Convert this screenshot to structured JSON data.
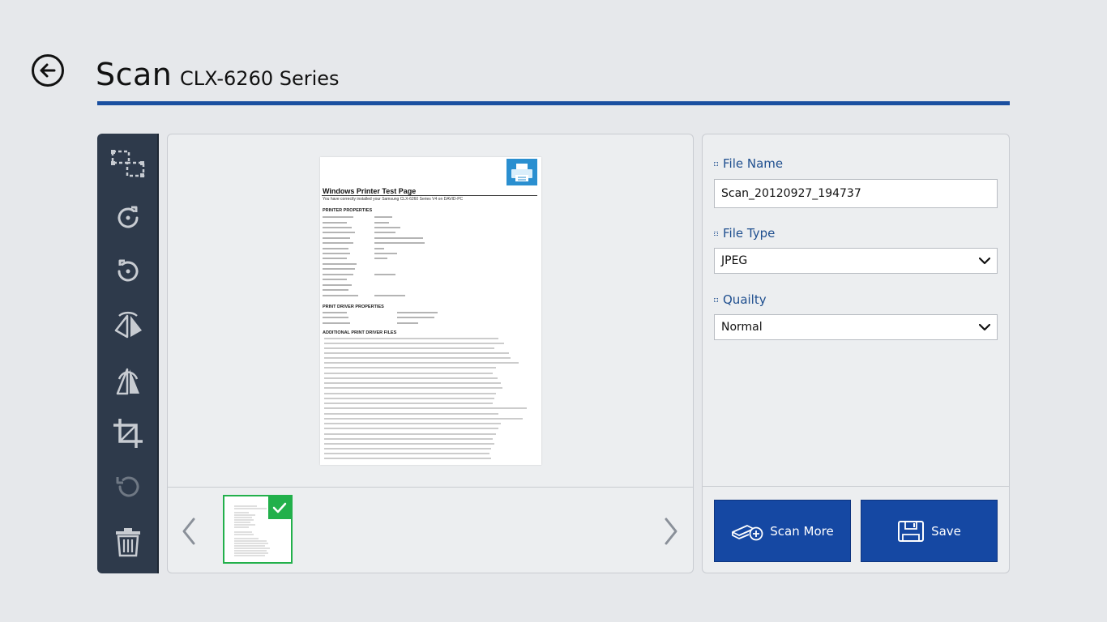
{
  "header": {
    "title": "Scan",
    "subtitle": "CLX-6260 Series"
  },
  "toolbar": {
    "tools": [
      "select-area",
      "rotate-right",
      "rotate-left",
      "flip-horizontal",
      "flip-vertical",
      "crop",
      "undo",
      "delete"
    ]
  },
  "preview": {
    "page_title": "Windows Printer Test Page",
    "page_subtitle": "You have correctly installed your Samsung CLX-6260 Series V4 on DAVID-PC",
    "sections": [
      "PRINTER PROPERTIES",
      "PRINT DRIVER PROPERTIES",
      "ADDITIONAL PRINT DRIVER FILES"
    ]
  },
  "settings": {
    "file_name_label": "File Name",
    "file_name_value": "Scan_20120927_194737",
    "file_type_label": "File Type",
    "file_type_value": "JPEG",
    "quality_label": "Quailty",
    "quality_value": "Normal"
  },
  "actions": {
    "scan_more_label": "Scan More",
    "save_label": "Save"
  },
  "colors": {
    "accent": "#1a4fa0",
    "button": "#1548a3",
    "toolbar": "#2e3a4b",
    "selected": "#22b04b"
  }
}
